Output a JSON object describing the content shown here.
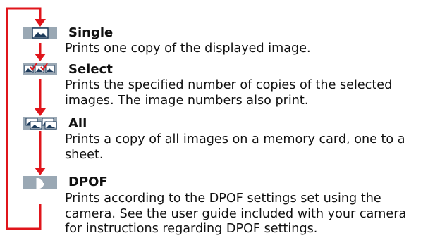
{
  "accent_color": "#e0151b",
  "items": [
    {
      "icon": "single-image-icon",
      "title": "Single",
      "lines": [
        "Prints one copy of the displayed image."
      ]
    },
    {
      "icon": "select-images-checkmark-icon",
      "title": "Select",
      "lines": [
        "Prints the specified number of copies of the selected",
        "images. The image numbers also print."
      ]
    },
    {
      "icon": "all-images-icon",
      "title": "All",
      "lines": [
        "Prints a copy of all images on a memory card, one to a",
        "sheet."
      ]
    },
    {
      "icon": "dpof-icon",
      "title": "DPOF",
      "lines": [
        "Prints according to the DPOF settings set using the",
        "camera. See the user guide included with your camera",
        "for instructions regarding DPOF settings."
      ]
    }
  ]
}
